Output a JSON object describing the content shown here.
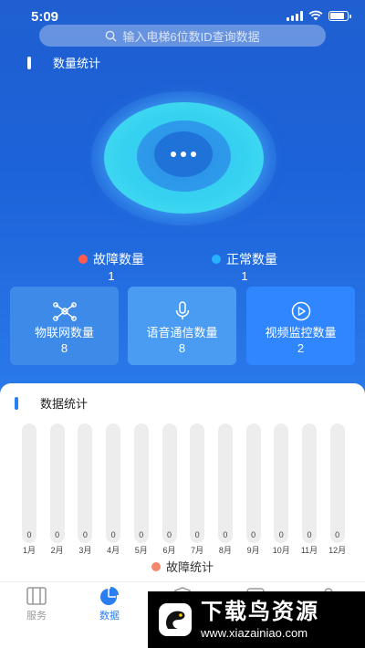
{
  "status_bar": {
    "time": "5:09"
  },
  "search": {
    "placeholder": "输入电梯6位数ID查询数据"
  },
  "overview": {
    "title": "数量统计",
    "fault": {
      "label": "故障数量",
      "count": "1",
      "color": "#ff5a4e"
    },
    "normal": {
      "label": "正常数量",
      "count": "1",
      "color": "#29b0ff"
    }
  },
  "cards": [
    {
      "label": "物联网数量",
      "count": "8",
      "icon": "network-icon",
      "bg": "#3d8ae8"
    },
    {
      "label": "语音通信数量",
      "count": "8",
      "icon": "microphone-icon",
      "bg": "#4a9cf3"
    },
    {
      "label": "视频监控数量",
      "count": "2",
      "icon": "play-icon",
      "bg": "#2f86ff"
    }
  ],
  "stats": {
    "title": "数据统计",
    "legend": "故障统计"
  },
  "chart_data": {
    "type": "bar",
    "categories": [
      "1月",
      "2月",
      "3月",
      "4月",
      "5月",
      "6月",
      "7月",
      "8月",
      "9月",
      "10月",
      "11月",
      "12月"
    ],
    "series": [
      {
        "name": "故障统计",
        "values": [
          0,
          0,
          0,
          0,
          0,
          0,
          0,
          0,
          0,
          0,
          0,
          0
        ]
      }
    ],
    "legend_position": "bottom",
    "grid": false
  },
  "tabs": [
    {
      "label": "服务",
      "icon": "service-icon",
      "active": false
    },
    {
      "label": "数据",
      "icon": "pie-chart-icon",
      "active": true
    }
  ],
  "watermark": {
    "title": "下载鸟资源",
    "url": "www.xiazainiao.com"
  }
}
